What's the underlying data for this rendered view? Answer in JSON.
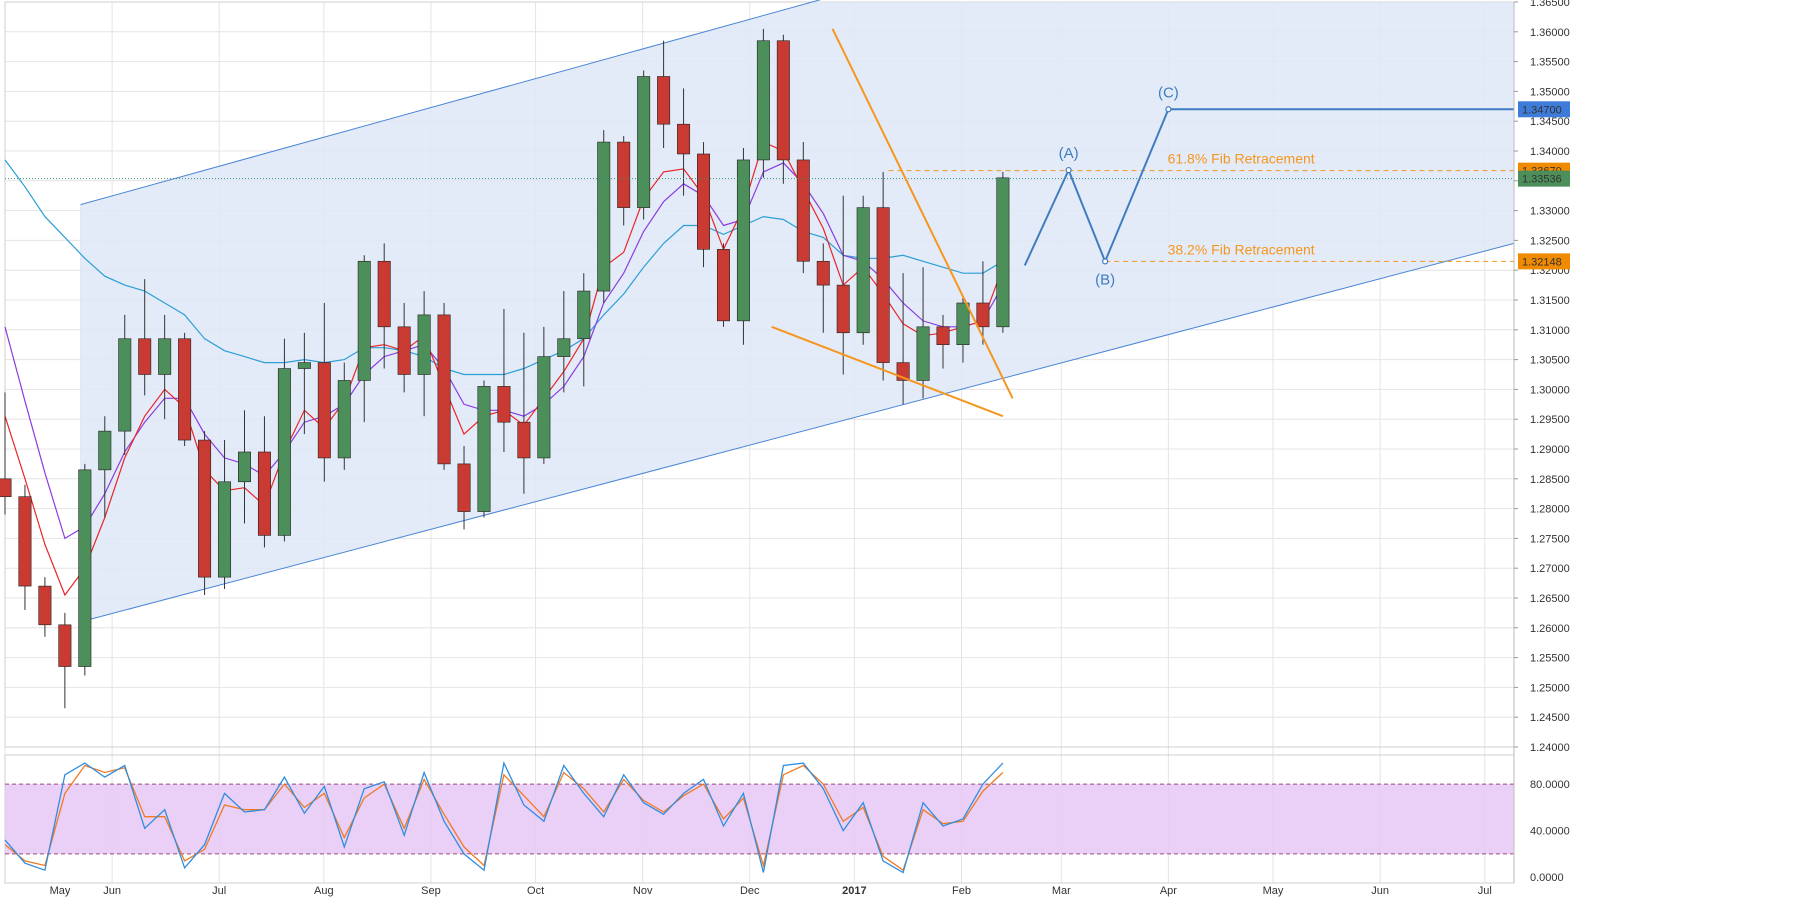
{
  "colors": {
    "channel_fill": "#dfe8f7",
    "channel_line": "#4a86d6",
    "grid": "#e4e4e4",
    "bull": "#4c8f5a",
    "bear": "#c93a32",
    "ema_red": "#e8262a",
    "ema_purple": "#8a3de0",
    "sma_blue": "#2a9fd6",
    "orange": "#f5961e",
    "wave": "#3f7cc2",
    "stoch_fill": "#e6c8f5",
    "stoch_blue": "#2f8de0",
    "stoch_orange": "#f07a24",
    "badge_blue": "#3f7cd9",
    "badge_orange": "#f08a00",
    "badge_green": "#4c8f5a"
  },
  "chart_data": {
    "type": "candlestick",
    "y_axis": {
      "range": [
        1.24,
        1.365
      ],
      "ticks": [
        "1.36500",
        "1.36000",
        "1.35500",
        "1.35000",
        "1.34500",
        "1.34000",
        "1.33500",
        "1.33000",
        "1.32500",
        "1.32000",
        "1.31500",
        "1.31000",
        "1.30500",
        "1.30000",
        "1.29500",
        "1.29000",
        "1.28500",
        "1.28000",
        "1.27500",
        "1.27000",
        "1.26500",
        "1.26000",
        "1.25500",
        "1.25000",
        "1.24500",
        "1.24000"
      ]
    },
    "x_axis": {
      "months": [
        "May",
        "Jun",
        "Jul",
        "Aug",
        "Sep",
        "Oct",
        "Nov",
        "Dec",
        "2017",
        "Feb",
        "Mar",
        "Apr",
        "May",
        "Jun",
        "Jul"
      ],
      "range_weeks": [
        0,
        62
      ]
    },
    "price_badges": [
      {
        "value": 1.347,
        "label": "1.34700",
        "color": "badge_blue"
      },
      {
        "value": 1.3367,
        "label": "1.33670",
        "color": "badge_orange"
      },
      {
        "value": 1.33536,
        "label": "1.33536",
        "color": "badge_green"
      },
      {
        "value": 1.32148,
        "label": "1.32148",
        "color": "badge_orange"
      }
    ],
    "current_price": 1.33536,
    "channel": {
      "upper": [
        [
          3.1,
          1.331
        ],
        [
          34.4,
          1.3664
        ]
      ],
      "lower": [
        [
          3.1,
          1.261
        ],
        [
          62.0,
          1.3245
        ]
      ]
    },
    "wedge": {
      "upper": [
        [
          34.0,
          1.3605
        ],
        [
          41.4,
          1.2985
        ]
      ],
      "lower": [
        [
          31.5,
          1.3105
        ],
        [
          41.0,
          1.2955
        ]
      ]
    },
    "fib_levels": [
      {
        "label": "61.8% Fib Retracement",
        "value": 1.3367
      },
      {
        "label": "38.2% Fib Retracement",
        "value": 1.32148
      }
    ],
    "wave_path": [
      [
        41.9,
        1.3208
      ],
      [
        43.7,
        1.3368
      ],
      [
        45.2,
        1.32148
      ],
      [
        47.8,
        1.347
      ],
      [
        62.0,
        1.347
      ]
    ],
    "wave_labels": [
      {
        "text": "(A)",
        "at": [
          43.7,
          1.3368
        ]
      },
      {
        "text": "(B)",
        "at": [
          45.2,
          1.32148
        ]
      },
      {
        "text": "(C)",
        "at": [
          47.8,
          1.347
        ]
      }
    ],
    "candles": [
      [
        1.285,
        1.2995,
        1.279,
        1.282
      ],
      [
        1.282,
        1.284,
        1.263,
        1.267
      ],
      [
        1.267,
        1.2685,
        1.2585,
        1.2605
      ],
      [
        1.2605,
        1.2625,
        1.2465,
        1.2535
      ],
      [
        1.2535,
        1.2875,
        1.252,
        1.2865
      ],
      [
        1.2865,
        1.2955,
        1.2785,
        1.293
      ],
      [
        1.293,
        1.3125,
        1.289,
        1.3085
      ],
      [
        1.3085,
        1.3185,
        1.299,
        1.3025
      ],
      [
        1.3025,
        1.3125,
        1.295,
        1.3085
      ],
      [
        1.3085,
        1.3095,
        1.2905,
        1.2915
      ],
      [
        1.2915,
        1.293,
        1.2655,
        1.2685
      ],
      [
        1.2685,
        1.2915,
        1.2665,
        1.2845
      ],
      [
        1.2845,
        1.2965,
        1.2775,
        1.2895
      ],
      [
        1.2895,
        1.2955,
        1.2735,
        1.2755
      ],
      [
        1.2755,
        1.3085,
        1.2745,
        1.3035
      ],
      [
        1.3035,
        1.3095,
        1.2925,
        1.3045
      ],
      [
        1.3045,
        1.3145,
        1.2845,
        1.2885
      ],
      [
        1.2885,
        1.3045,
        1.2865,
        1.3015
      ],
      [
        1.3015,
        1.3225,
        1.2945,
        1.3215
      ],
      [
        1.3215,
        1.3245,
        1.3035,
        1.3105
      ],
      [
        1.3105,
        1.3145,
        1.2995,
        1.3025
      ],
      [
        1.3025,
        1.3165,
        1.2955,
        1.3125
      ],
      [
        1.3125,
        1.3145,
        1.2865,
        1.2875
      ],
      [
        1.2875,
        1.2905,
        1.2765,
        1.2795
      ],
      [
        1.2795,
        1.3015,
        1.2785,
        1.3005
      ],
      [
        1.3005,
        1.3135,
        1.2895,
        1.2945
      ],
      [
        1.2945,
        1.3095,
        1.2825,
        1.2885
      ],
      [
        1.2885,
        1.3105,
        1.2875,
        1.3055
      ],
      [
        1.3055,
        1.3165,
        1.2995,
        1.3085
      ],
      [
        1.3085,
        1.3195,
        1.3005,
        1.3165
      ],
      [
        1.3165,
        1.3435,
        1.3145,
        1.3415
      ],
      [
        1.3415,
        1.3425,
        1.3275,
        1.3305
      ],
      [
        1.3305,
        1.3535,
        1.3285,
        1.3525
      ],
      [
        1.3525,
        1.3585,
        1.3405,
        1.3445
      ],
      [
        1.3445,
        1.3505,
        1.3325,
        1.3395
      ],
      [
        1.3395,
        1.3415,
        1.3205,
        1.3235
      ],
      [
        1.3235,
        1.3245,
        1.3105,
        1.3115
      ],
      [
        1.3115,
        1.3405,
        1.3075,
        1.3385
      ],
      [
        1.3385,
        1.3605,
        1.3355,
        1.3585
      ],
      [
        1.3585,
        1.3595,
        1.3345,
        1.3385
      ],
      [
        1.3385,
        1.3415,
        1.3195,
        1.3215
      ],
      [
        1.3215,
        1.3245,
        1.3095,
        1.3175
      ],
      [
        1.3175,
        1.3325,
        1.3025,
        1.3095
      ],
      [
        1.3095,
        1.3325,
        1.3075,
        1.3305
      ],
      [
        1.3305,
        1.3365,
        1.3015,
        1.3045
      ],
      [
        1.3045,
        1.3195,
        1.2975,
        1.3015
      ],
      [
        1.3015,
        1.3205,
        1.2985,
        1.3105
      ],
      [
        1.3105,
        1.3125,
        1.3035,
        1.3075
      ],
      [
        1.3075,
        1.3155,
        1.3045,
        1.3145
      ],
      [
        1.3145,
        1.3215,
        1.3075,
        1.3105
      ],
      [
        1.3105,
        1.3365,
        1.3095,
        1.3355
      ]
    ],
    "ema_red": [
      1.2955,
      1.285,
      1.274,
      1.2655,
      1.27,
      1.2785,
      1.2885,
      1.2955,
      1.3,
      1.297,
      1.2865,
      1.283,
      1.2835,
      1.2805,
      1.2895,
      1.2965,
      1.2935,
      1.298,
      1.307,
      1.3075,
      1.3065,
      1.309,
      1.3005,
      1.2925,
      1.2955,
      1.2965,
      1.294,
      1.2985,
      1.303,
      1.3085,
      1.3205,
      1.323,
      1.332,
      1.3365,
      1.337,
      1.3325,
      1.3235,
      1.3305,
      1.3415,
      1.34,
      1.3335,
      1.327,
      1.3175,
      1.3205,
      1.316,
      1.311,
      1.309,
      1.3095,
      1.3105,
      1.3115,
      1.3205
    ],
    "ema_purple": [
      1.3105,
      1.298,
      1.286,
      1.275,
      1.277,
      1.2825,
      1.2895,
      1.2945,
      1.2985,
      1.2985,
      1.2925,
      1.2885,
      1.2875,
      1.2855,
      1.2895,
      1.2945,
      1.2955,
      1.2975,
      1.3025,
      1.3055,
      1.3065,
      1.3075,
      1.3035,
      1.2975,
      1.2965,
      1.2965,
      1.2955,
      1.2975,
      1.3005,
      1.3055,
      1.3145,
      1.3195,
      1.3265,
      1.3315,
      1.3345,
      1.3325,
      1.3275,
      1.3285,
      1.3365,
      1.338,
      1.3345,
      1.3295,
      1.3225,
      1.3215,
      1.3185,
      1.3145,
      1.3115,
      1.3105,
      1.3105,
      1.3115,
      1.3175
    ],
    "sma_blue": [
      1.3385,
      1.334,
      1.329,
      1.3255,
      1.322,
      1.319,
      1.3175,
      1.3165,
      1.3145,
      1.3125,
      1.3085,
      1.3065,
      1.3055,
      1.3045,
      1.3045,
      1.305,
      1.3045,
      1.305,
      1.307,
      1.307,
      1.3065,
      1.3055,
      1.3035,
      1.3025,
      1.3025,
      1.3025,
      1.3035,
      1.305,
      1.3065,
      1.3085,
      1.3125,
      1.316,
      1.3205,
      1.3245,
      1.3275,
      1.3275,
      1.326,
      1.3275,
      1.329,
      1.3285,
      1.3265,
      1.3255,
      1.3225,
      1.322,
      1.322,
      1.3225,
      1.3215,
      1.3205,
      1.3195,
      1.3195,
      1.3215
    ],
    "stochastic": {
      "ticks": [
        "80.0000",
        "40.0000",
        "0.0000"
      ],
      "range": [
        -5,
        105
      ],
      "band": [
        20,
        80
      ],
      "k": [
        32,
        12,
        6,
        88,
        98,
        86,
        96,
        42,
        58,
        8,
        28,
        72,
        56,
        58,
        86,
        55,
        78,
        26,
        76,
        82,
        36,
        90,
        48,
        20,
        6,
        98,
        62,
        48,
        96,
        72,
        52,
        88,
        64,
        54,
        72,
        84,
        44,
        72,
        4,
        96,
        98,
        76,
        40,
        64,
        14,
        4,
        64,
        44,
        50,
        80,
        98
      ],
      "d": [
        28,
        14,
        10,
        72,
        96,
        90,
        94,
        52,
        52,
        14,
        24,
        62,
        58,
        58,
        80,
        60,
        72,
        34,
        68,
        80,
        42,
        84,
        54,
        26,
        10,
        88,
        70,
        52,
        90,
        76,
        56,
        84,
        66,
        56,
        70,
        80,
        50,
        68,
        10,
        88,
        96,
        80,
        48,
        60,
        18,
        6,
        58,
        46,
        48,
        74,
        90
      ]
    }
  }
}
